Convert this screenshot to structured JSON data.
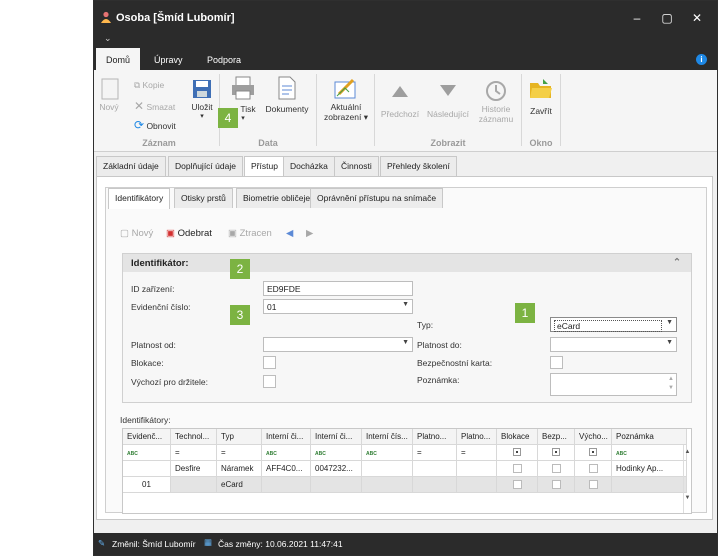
{
  "window": {
    "title": "Osoba [Šmíd Lubomír]",
    "qa_arrow": "⌄",
    "controls": {
      "minimize": "–",
      "maximize": "▢",
      "close": "✕"
    }
  },
  "menu": {
    "tabs": [
      "Domů",
      "Úpravy",
      "Podpora"
    ],
    "active": "Domů",
    "help": "i"
  },
  "ribbon": {
    "novy": "Nový",
    "kopie": "Kopie",
    "smazat": "Smazat",
    "obnovit": "Obnovit",
    "ulozit": "Uložit",
    "tisk": "Tisk",
    "dokumenty": "Dokumenty",
    "aktualni": "Aktuální",
    "zobrazeni": "zobrazení",
    "predchozi": "Předchozí",
    "nasledujici": "Následující",
    "historie": "Historie",
    "zaznamu": "záznamu",
    "zavrit": "Zavřít",
    "groups": {
      "zaznam": "Záznam",
      "data": "Data",
      "zobrazit": "Zobrazit",
      "okno": "Okno"
    }
  },
  "tabs": [
    "Základní údaje",
    "Doplňující údaje",
    "Přístup",
    "Docházka",
    "Činnosti",
    "Přehledy školení"
  ],
  "subtabs": [
    "Identifikátory",
    "Otisky prstů",
    "Biometrie obličeje",
    "Oprávnění přístupu na snímače"
  ],
  "toolbar": {
    "novy": "Nový",
    "odebrat": "Odebrat",
    "ztracen": "Ztracen",
    "prev": "◀",
    "next": "▶"
  },
  "form": {
    "title": "Identifikátor:",
    "collapse": "⌃",
    "id_label": "ID zařízení:",
    "id_value": "ED9FDE",
    "evid_label": "Evidenční číslo:",
    "evid_value": "01",
    "typ_label": "Typ:",
    "typ_value": "eCard",
    "platnost_od": "Platnost od:",
    "platnost_do": "Platnost do:",
    "blokace": "Blokace:",
    "bezpecnostni": "Bezpečnostní karta:",
    "vychozi": "Výchozí pro držitele:",
    "poznamka": "Poznámka:"
  },
  "grid": {
    "label": "Identifikátory:",
    "headers": [
      "Evidenč...",
      "Technol...",
      "Typ",
      "Interní či...",
      "Interní či...",
      "Interní čís...",
      "Platno...",
      "Platno...",
      "Blokace",
      "Bezp...",
      "Výcho...",
      "Poznámka"
    ],
    "filter_abc": "ABC",
    "filter_eq": "=",
    "rows": [
      [
        "",
        "Desfire",
        "Náramek",
        "AFF4C0...",
        "0047232...",
        "",
        "",
        "",
        "",
        "",
        "",
        "Hodinky Ap..."
      ],
      [
        "01",
        "",
        "eCard",
        "",
        "",
        "",
        "",
        "",
        "",
        "",
        "",
        ""
      ]
    ]
  },
  "status": {
    "changed_by": "Změnil: Šmíd Lubomír",
    "changed_at": "Čas změny: 10.06.2021 11:47:41"
  },
  "badges": [
    "1",
    "2",
    "3",
    "4"
  ],
  "colors": {
    "accent": "#7cb342",
    "titlebar": "#2b2b2b",
    "help": "#1e88e5"
  }
}
